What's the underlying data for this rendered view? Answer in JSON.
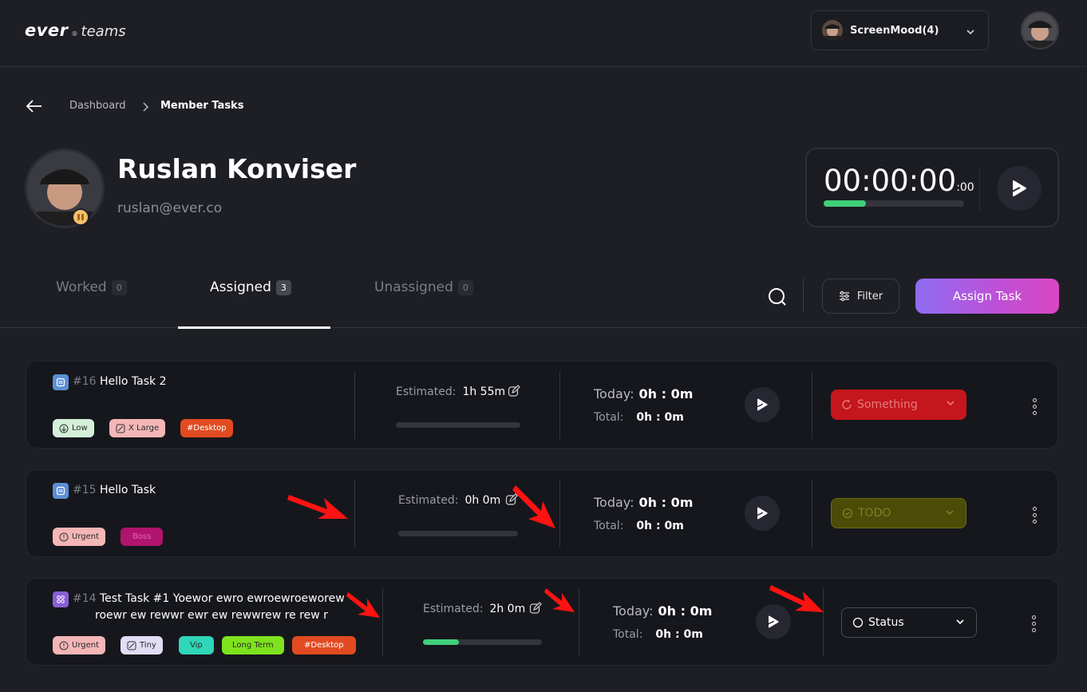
{
  "header": {
    "logo_ever": "ever",
    "logo_reg": "®",
    "logo_teams": "teams",
    "team_name": "ScreenMood(4)"
  },
  "breadcrumb": {
    "items": [
      "Dashboard",
      "Member Tasks"
    ]
  },
  "profile": {
    "name": "Ruslan Konviser",
    "email": "ruslan@ever.co"
  },
  "timer": {
    "time": "00:00:00",
    "ms": ":00",
    "progress": 0.3
  },
  "tabs": [
    {
      "label": "Worked",
      "count": "0"
    },
    {
      "label": "Assigned",
      "count": "3"
    },
    {
      "label": "Unassigned",
      "count": "0"
    }
  ],
  "toolbar": {
    "filter_label": "Filter",
    "assign_label": "Assign Task"
  },
  "tasks": [
    {
      "number": "#16",
      "title": "Hello Task 2",
      "tags": [
        {
          "label": "Low",
          "color": "#d4f0d9",
          "icon": "arrow-down-circle-icon"
        },
        {
          "label": "X Large",
          "color": "#f4b6b6",
          "icon": "size-icon"
        },
        {
          "label": "#Desktop",
          "color": "#e14b21",
          "text_color": "#ffffff"
        }
      ],
      "estimated_label": "Estimated:",
      "estimated": "1h 55m",
      "estimate_progress": 0,
      "today_label": "Today:",
      "today": "0h : 0m",
      "total_label": "Total:",
      "total": "0h : 0m",
      "status": "Something",
      "status_color": "#c4161c",
      "status_text_color": "#e87b7b"
    },
    {
      "number": "#15",
      "title": "Hello Task",
      "tags": [
        {
          "label": "Urgent",
          "color": "#f4b6b6",
          "icon": "alert-circle-icon"
        },
        {
          "label": "Boss",
          "color": "#b0146e",
          "text_color": "#e16aa9"
        }
      ],
      "estimated_label": "Estimated:",
      "estimated": "0h 0m",
      "estimate_progress": 0,
      "today_label": "Today:",
      "today": "0h : 0m",
      "total_label": "Total:",
      "total": "0h : 0m",
      "status": "TODO",
      "status_color": "#4a4c08",
      "status_text_color": "#7e8222"
    },
    {
      "number": "#14",
      "title_line1": "Test Task #1 Yoewor ewro ewroewroeworew",
      "title_line2": "roewr ew rewwr ewr ew rewwrew re rew r",
      "tags": [
        {
          "label": "Urgent",
          "color": "#f4b6b6",
          "icon": "alert-circle-icon"
        },
        {
          "label": "Tiny",
          "color": "#e2dcf5",
          "icon": "size-icon"
        },
        {
          "label": "Vip",
          "color": "#2fd6b9"
        },
        {
          "label": "Long Term",
          "color": "#7ee21d"
        },
        {
          "label": "#Desktop",
          "color": "#e14b21",
          "text_color": "#ffffff"
        }
      ],
      "estimated_label": "Estimated:",
      "estimated": "2h 0m",
      "estimate_progress": 0.3,
      "today_label": "Today:",
      "today": "0h : 0m",
      "total_label": "Total:",
      "total": "0h : 0m",
      "status": "Status"
    }
  ]
}
